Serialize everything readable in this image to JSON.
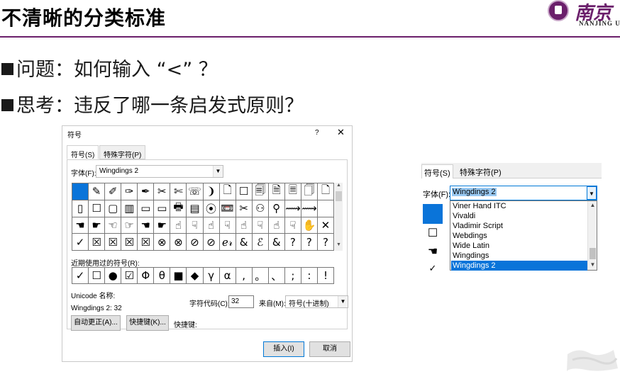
{
  "slide": {
    "title": "不清晰的分类标准",
    "logo": {
      "subtext": "NANJING U"
    },
    "bullets": [
      "问题：如何输入 “<” ？",
      "思考：违反了哪一条启发式原则？"
    ]
  },
  "dialog": {
    "title": "符号",
    "help": "?",
    "close": "✕",
    "tabs": [
      "符号(S)",
      "特殊字符(P)"
    ],
    "font_label": "字体(F):",
    "font_value": "Wingdings 2",
    "symbol_grid": [
      [
        "",
        "✎",
        "✐",
        "✑",
        "✒",
        "✂",
        "✄",
        "☏",
        "❩",
        "🗋",
        "☐",
        "🗐",
        "🗎",
        "🗏",
        "🗍",
        "🗋"
      ],
      [
        "▯",
        "☐",
        "▢",
        "▥",
        "▭",
        "▭",
        "🖶",
        "▤",
        "⦿",
        "📼",
        "✂",
        "⚇",
        "⚲",
        "⟿",
        "⟿",
        ""
      ],
      [
        "☚",
        "☛",
        "☜",
        "☞",
        "☚",
        "☛",
        "☝",
        "☟",
        "☝",
        "☟",
        "☝",
        "☟",
        "☝",
        "☟",
        "✋",
        "✕"
      ],
      [
        "✓",
        "☒",
        "☒",
        "☒",
        "☒",
        "⊗",
        "⊗",
        "⊘",
        "⊘",
        "ℯ𝓇",
        "&",
        "ℰ",
        "&",
        "?",
        "?",
        "?"
      ]
    ],
    "recent_label": "近期使用过的符号(R):",
    "recent_symbols": [
      "✓",
      "☐",
      "●",
      "☑",
      "Φ",
      "θ",
      "■",
      "◆",
      "γ",
      "α",
      ",",
      "。",
      "、",
      ";",
      ":",
      "!"
    ],
    "unicode_label": "Unicode 名称:",
    "unicode_name": "Wingdings 2: 32",
    "charcode_label": "字符代码(C):",
    "charcode_value": "32",
    "from_label": "来自(M):",
    "from_value": "符号(十进制)",
    "autocorrect_button": "自动更正(A)...",
    "shortcut_button": "快捷键(K)...",
    "shortcut_label": "快捷键:",
    "insert_button": "插入(I)",
    "cancel_button": "取消"
  },
  "zoom": {
    "tabs": [
      "符号(S)",
      "特殊字符(P)"
    ],
    "font_label": "字体(F):",
    "font_value": "Wingdings 2",
    "font_options": [
      "Viner Hand ITC",
      "Vivaldi",
      "Vladimir Script",
      "Webdings",
      "Wide Latin",
      "Wingdings",
      "Wingdings 2"
    ],
    "selected_font": "Wingdings 2",
    "partial_symbols": [
      "☐",
      "☚",
      "✓"
    ]
  },
  "icons": {
    "dropdown_arrow": "chevron-down-icon",
    "scroll_up": "scroll-up-icon",
    "scroll_down": "scroll-down-icon",
    "close": "close-icon",
    "help": "help-icon"
  },
  "colors": {
    "accent_purple": "#6b1f6b",
    "selection_blue": "#0a74d9"
  }
}
